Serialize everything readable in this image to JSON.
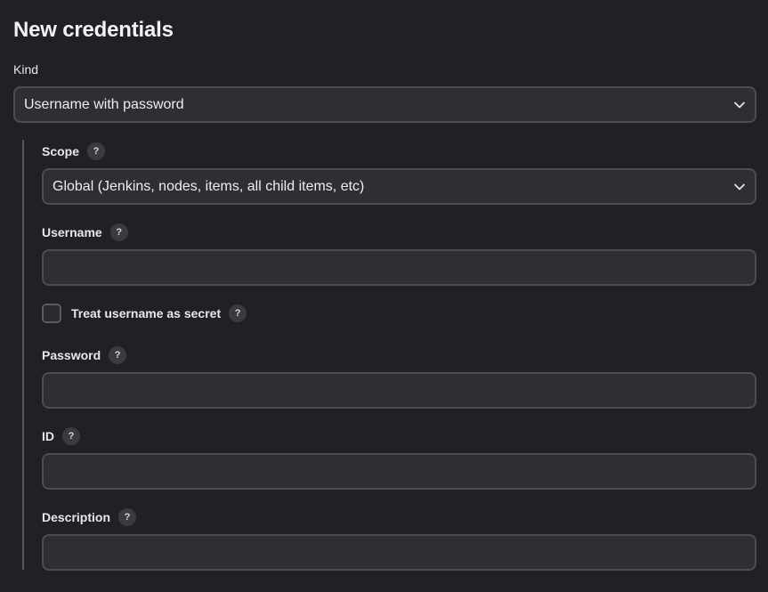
{
  "page_title": "New credentials",
  "kind": {
    "label": "Kind",
    "selected": "Username with password"
  },
  "scope": {
    "label": "Scope",
    "help": "?",
    "selected": "Global (Jenkins, nodes, items, all child items, etc)"
  },
  "username": {
    "label": "Username",
    "help": "?",
    "value": ""
  },
  "treat_username_secret": {
    "label": "Treat username as secret",
    "help": "?",
    "checked": false
  },
  "password": {
    "label": "Password",
    "help": "?",
    "value": ""
  },
  "id": {
    "label": "ID",
    "help": "?",
    "value": ""
  },
  "description": {
    "label": "Description",
    "help": "?",
    "value": ""
  },
  "colors": {
    "background": "#202124",
    "field_background": "#2e2f33",
    "field_border": "#4c4d52",
    "text": "#e8e8ea"
  },
  "icons": {
    "dropdown": "chevron-down-icon",
    "help": "help-icon"
  }
}
